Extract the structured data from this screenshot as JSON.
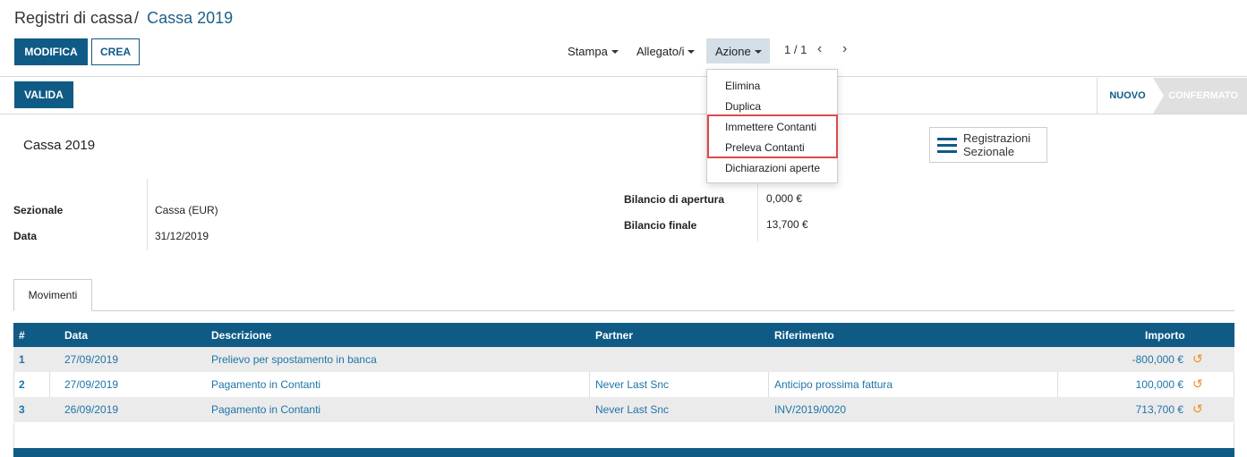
{
  "breadcrumb": {
    "parent": "Registri di cassa",
    "separator": "/",
    "current": "Cassa 2019"
  },
  "buttons": {
    "edit": "MODIFICA",
    "create": "CREA",
    "validate": "VALIDA"
  },
  "sidebar": {
    "print": "Stampa",
    "attachments": "Allegato/i",
    "action": "Azione"
  },
  "pager": {
    "value": "1 / 1",
    "prev": "‹",
    "next": "›"
  },
  "action_menu": {
    "items": [
      "Elimina",
      "Duplica",
      "Immettere Contanti",
      "Preleva Contanti",
      "Dichiarazioni aperte"
    ]
  },
  "status": {
    "new": "NUOVO",
    "confirmed": "CONFERMATO",
    "active": "NUOVO"
  },
  "form": {
    "name": "Cassa 2019",
    "journal_label": "Sezionale",
    "journal_value": "Cassa (EUR)",
    "date_label": "Data",
    "date_value": "31/12/2019",
    "opening_label": "Bilancio di apertura",
    "opening_value": "0,000 €",
    "closing_label": "Bilancio finale",
    "closing_value": "13,700 €"
  },
  "smart_button": {
    "line1": "Registrazioni",
    "line2": "Sezionale"
  },
  "tabs": [
    {
      "label": "Movimenti",
      "active": true
    }
  ],
  "table": {
    "headers": [
      "#",
      "Data",
      "Descrizione",
      "Partner",
      "Riferimento",
      "Importo"
    ],
    "rows": [
      {
        "num": "1",
        "date": "27/09/2019",
        "description": "Prelievo per spostamento in banca",
        "partner": "",
        "reference": "",
        "amount": "-800,000 €"
      },
      {
        "num": "2",
        "date": "27/09/2019",
        "description": "Pagamento in Contanti",
        "partner": "Never Last Snc",
        "reference": "Anticipo prossima fattura",
        "amount": "100,000 €"
      },
      {
        "num": "3",
        "date": "26/09/2019",
        "description": "Pagamento in Contanti",
        "partner": "Never Last Snc",
        "reference": "INV/2019/0020",
        "amount": "713,700 €"
      }
    ]
  },
  "colors": {
    "primary": "#0f5b86",
    "link": "#1e74a8",
    "highlight": "#e04848",
    "refresh_icon": "#f08c1e"
  },
  "icons": {
    "row_action": "undo-icon",
    "smart_button": "list-icon"
  }
}
